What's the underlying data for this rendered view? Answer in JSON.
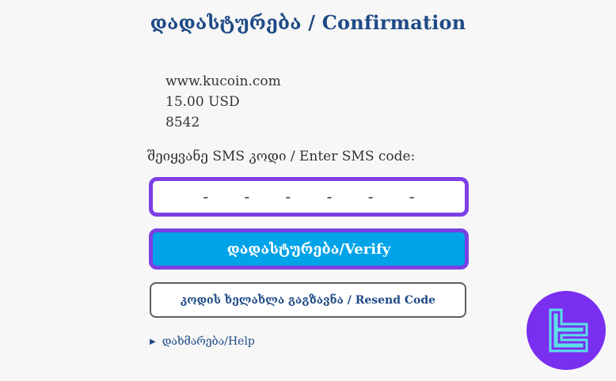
{
  "header": {
    "title": "დადასტურება / Confirmation"
  },
  "details": {
    "merchant": "www.kucoin.com",
    "amount": "15.00 USD",
    "card_last4": "8542"
  },
  "sms": {
    "label": "შეიყვანე SMS კოდი / Enter SMS code:",
    "value": "- - - - - -"
  },
  "actions": {
    "verify_label": "დადასტურება/Verify",
    "resend_label": "კოდის ხელახლა გაგზავნა / Resend Code"
  },
  "help": {
    "label": "დახმარება/Help",
    "expander_icon": "triangle-right-icon"
  },
  "brand": {
    "logo_icon": "tc-logo-icon",
    "color": "#7a2ff0"
  },
  "colors": {
    "title": "#1e4a86",
    "accent_border": "#7b3fe4",
    "verify_bg": "#00a3e8",
    "background": "#f7f7f7"
  }
}
